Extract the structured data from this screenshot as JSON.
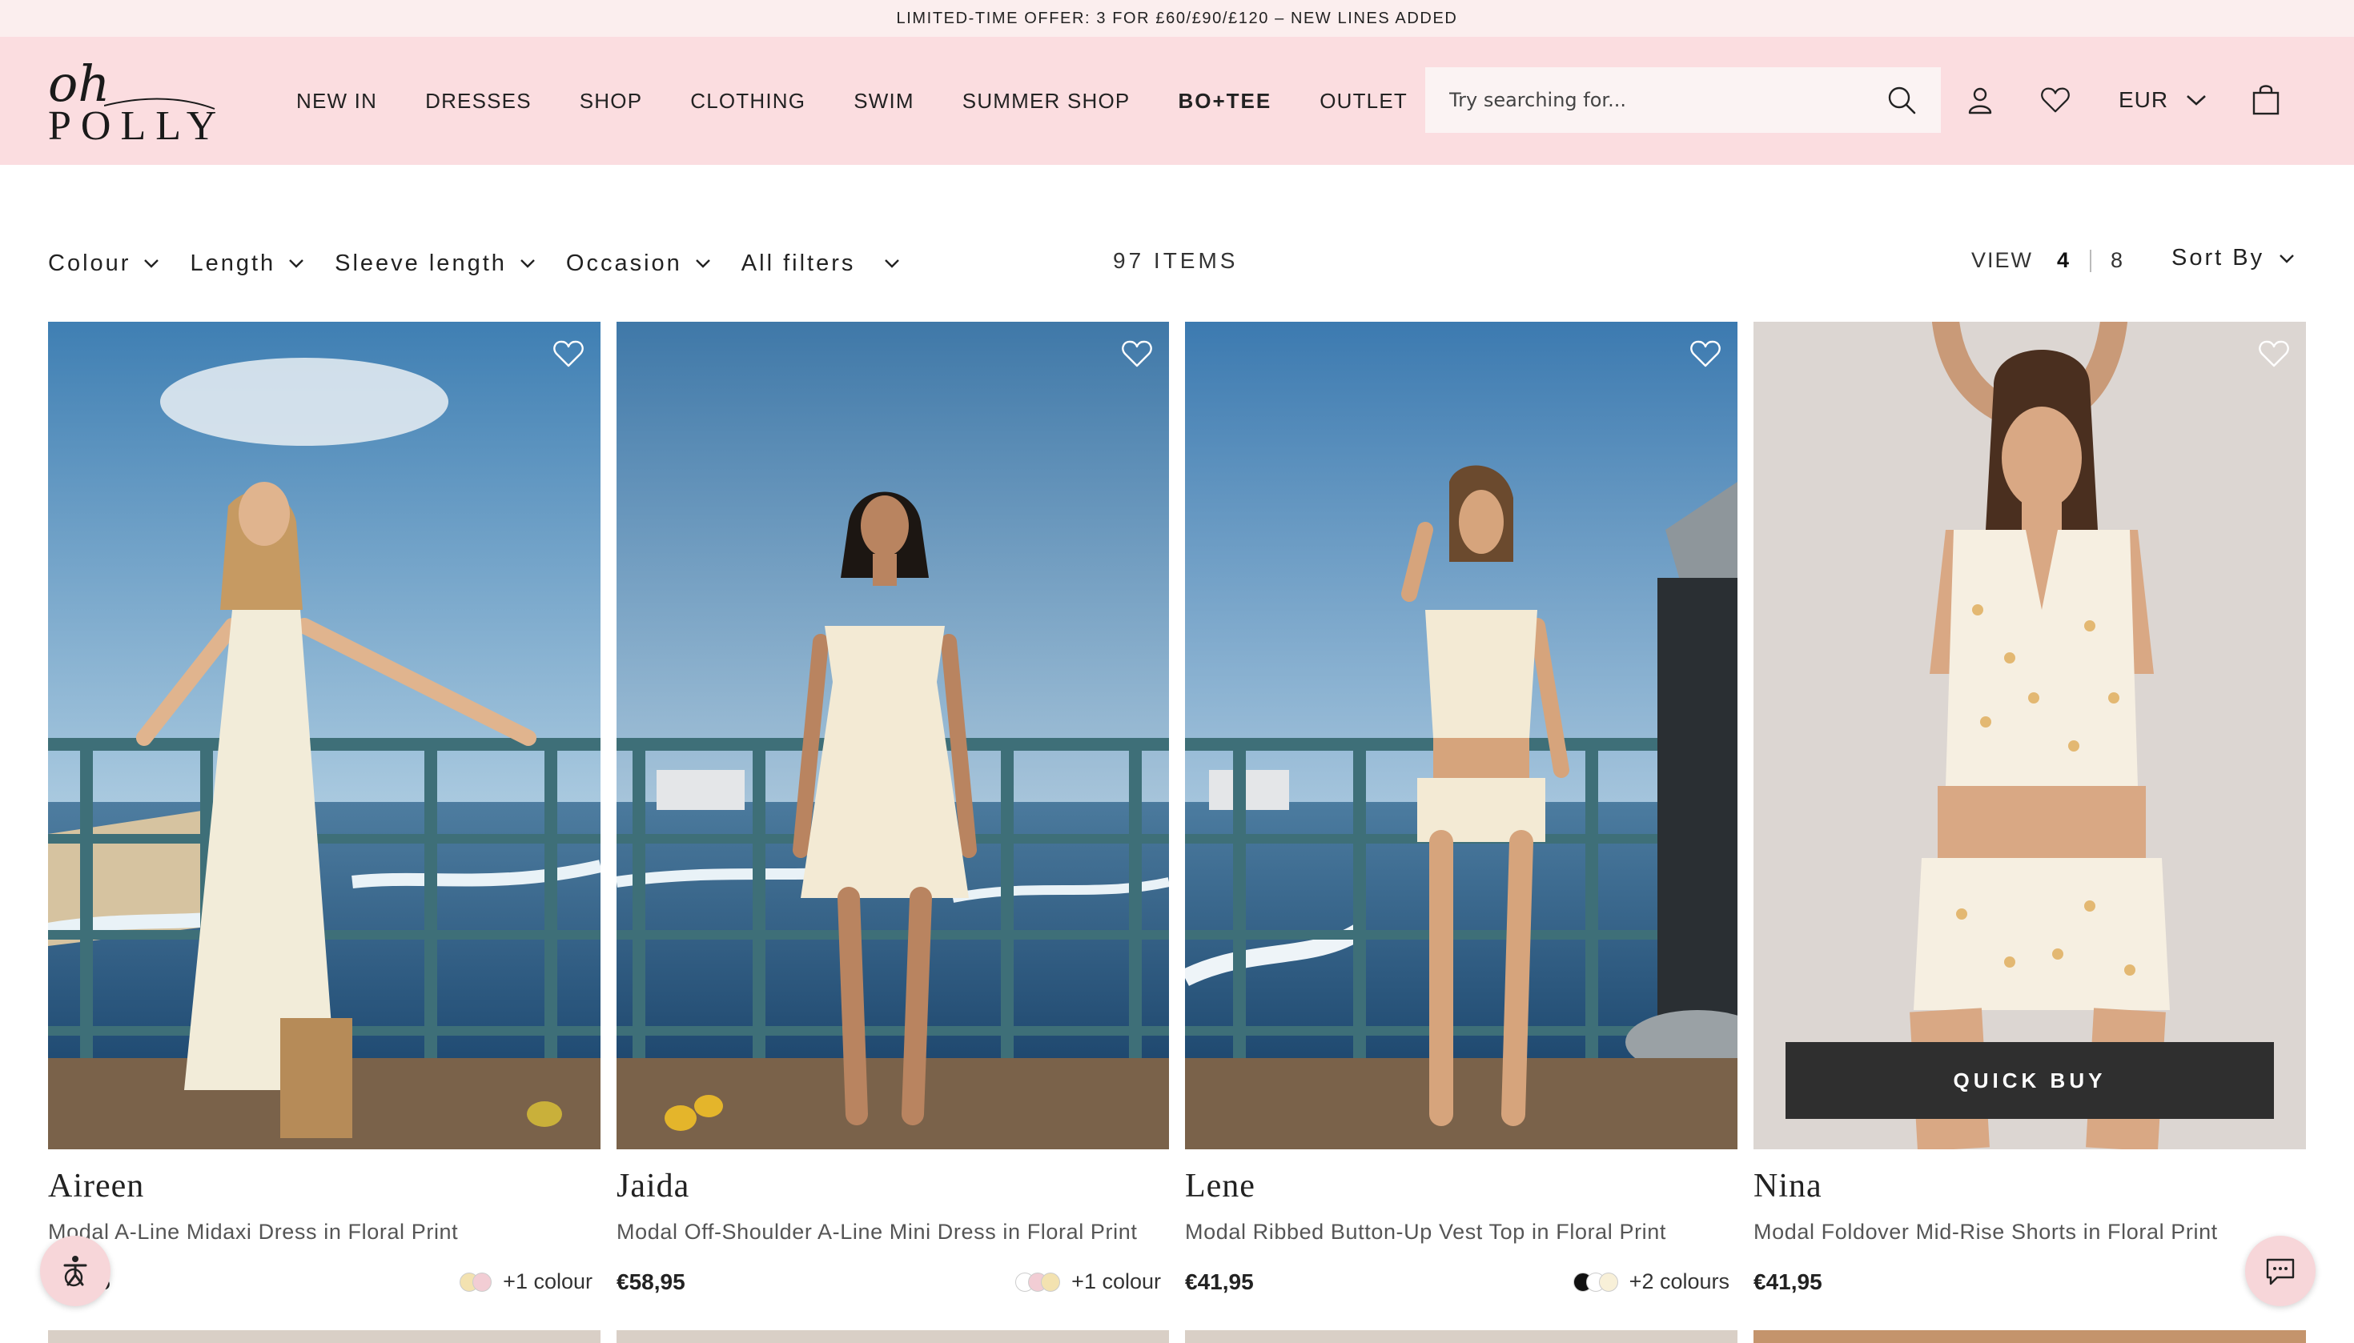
{
  "promo": {
    "text": "LIMITED-TIME OFFER: 3 FOR £60/£90/£120 – NEW LINES ADDED"
  },
  "logo": {
    "top": "oh",
    "bottom": "POLLY"
  },
  "nav": {
    "items": [
      {
        "label": "NEW IN"
      },
      {
        "label": "DRESSES"
      },
      {
        "label": "SHOP"
      },
      {
        "label": "CLOTHING"
      },
      {
        "label": "SWIM"
      },
      {
        "label": "SUMMER SHOP"
      },
      {
        "label": "BO+TEE"
      },
      {
        "label": "OUTLET"
      }
    ]
  },
  "search": {
    "placeholder": "Try searching for..."
  },
  "currency": {
    "value": "EUR"
  },
  "filters": {
    "items": [
      {
        "label": "Colour"
      },
      {
        "label": "Length"
      },
      {
        "label": "Sleeve length"
      },
      {
        "label": "Occasion"
      },
      {
        "label": "All filters"
      }
    ],
    "count": "97 ITEMS",
    "view_label": "VIEW",
    "view_options": [
      "4",
      "8"
    ],
    "sort_label": "Sort By"
  },
  "products": [
    {
      "name": "Aireen",
      "description": "Modal A-Line Midaxi Dress in Floral Print",
      "price": "5",
      "more_colours": "+1 colour",
      "swatches": [
        "#f3e2b0",
        "#f2cdd4"
      ]
    },
    {
      "name": "Jaida",
      "description": "Modal Off-Shoulder A-Line Mini Dress in Floral Print",
      "price": "€58,95",
      "more_colours": "+1 colour",
      "swatches": [
        "#ffffff",
        "#f2cdd4",
        "#f3e2b0"
      ]
    },
    {
      "name": "Lene",
      "description": "Modal Ribbed Button-Up Vest Top in Floral Print",
      "price": "€41,95",
      "more_colours": "+2 colours",
      "swatches": [
        "#111111",
        "#ffffff",
        "#f8f0d8"
      ]
    },
    {
      "name": "Nina",
      "description": "Modal Foldover Mid-Rise Shorts in Floral Print",
      "price": "€41,95",
      "more_colours": "",
      "swatches": [],
      "quick_buy": "QUICK BUY"
    }
  ],
  "colors": {
    "header_bg": "#fbdde0",
    "promo_bg": "#fbeeee",
    "quick_buy_bg": "#2f2f2f"
  }
}
